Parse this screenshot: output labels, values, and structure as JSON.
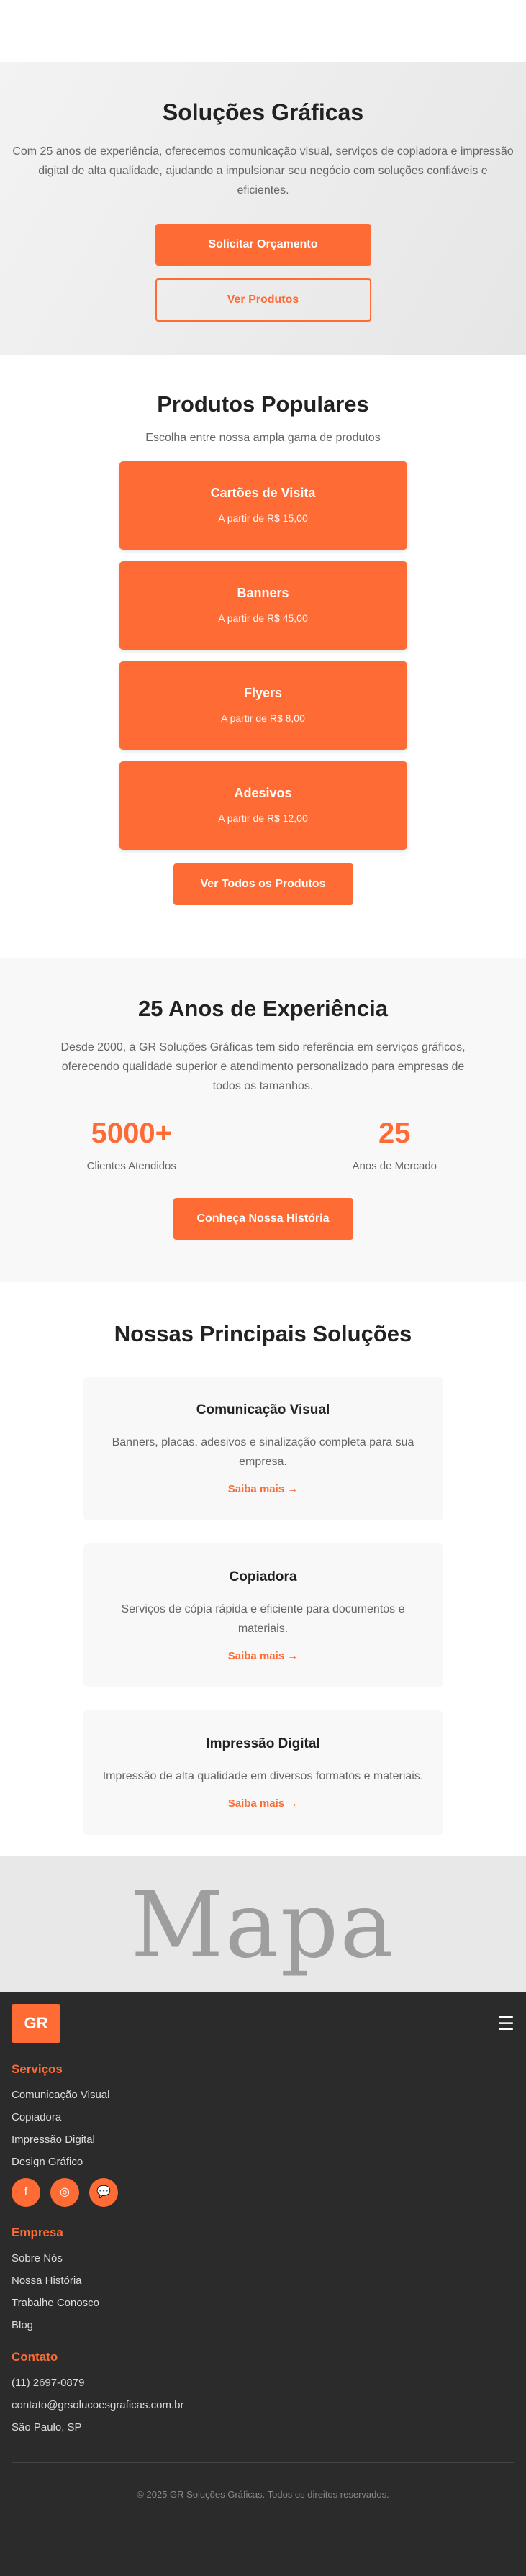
{
  "hero": {
    "title": "Soluções Gráficas",
    "description": "Com 25 anos de experiência, oferecemos comunicação visual, serviços de copiadora e impressão digital de alta qualidade, ajudando a impulsionar seu negócio com soluções confiáveis e eficientes.",
    "cta_primary": "Solicitar Orçamento",
    "cta_secondary": "Ver Produtos"
  },
  "products": {
    "title": "Produtos Populares",
    "subtitle": "Escolha entre nossa ampla gama de produtos",
    "items": [
      {
        "name": "Cartões de Visita",
        "price": "A partir de R$ 15,00"
      },
      {
        "name": "Banners",
        "price": "A partir de R$ 45,00"
      },
      {
        "name": "Flyers",
        "price": "A partir de R$ 8,00"
      },
      {
        "name": "Adesivos",
        "price": "A partir de R$ 12,00"
      }
    ],
    "cta": "Ver Todos os Produtos"
  },
  "experience": {
    "title": "25 Anos de Experiência",
    "text": "Desde 2000, a GR Soluções Gráficas tem sido referência em serviços gráficos, oferecendo qualidade superior e atendimento personalizado para empresas de todos os tamanhos.",
    "stats": [
      {
        "value": "5000+",
        "label": "Clientes Atendidos"
      },
      {
        "value": "25",
        "label": "Anos de Mercado"
      }
    ],
    "cta": "Conheça Nossa História"
  },
  "solutions": {
    "title": "Nossas Principais Soluções",
    "items": [
      {
        "title": "Comunicação Visual",
        "text": "Banners, placas, adesivos e sinalização completa para sua empresa.",
        "link": "Saiba mais →"
      },
      {
        "title": "Copiadora",
        "text": "Serviços de cópia rápida e eficiente para documentos e materiais.",
        "link": "Saiba mais →"
      },
      {
        "title": "Impressão Digital",
        "text": "Impressão de alta qualidade em diversos formatos e materiais.",
        "link": "Saiba mais →"
      }
    ]
  },
  "map": {
    "label": "Mapa"
  },
  "footer": {
    "logo": "GR",
    "menu_icon": "☰",
    "services_heading": "Serviços",
    "services": [
      "Comunicação Visual",
      "Copiadora",
      "Impressão Digital",
      "Design Gráfico"
    ],
    "socials": [
      {
        "icon": "facebook-icon",
        "glyph": "f"
      },
      {
        "icon": "instagram-icon",
        "glyph": "◎"
      },
      {
        "icon": "whatsapp-icon",
        "glyph": "💬"
      }
    ],
    "company_heading": "Empresa",
    "company": [
      "Sobre Nós",
      "Nossa História",
      "Trabalhe Conosco",
      "Blog"
    ],
    "contact_heading": "Contato",
    "contact": [
      "(11) 2697-0879",
      "contato@grsolucoesgraficas.com.br",
      "São Paulo, SP"
    ],
    "copyright": "© 2025 GR Soluções Gráficas. Todos os direitos reservados."
  },
  "colors": {
    "accent": "#ff6b35",
    "footer_bg": "#2b2b2b"
  }
}
